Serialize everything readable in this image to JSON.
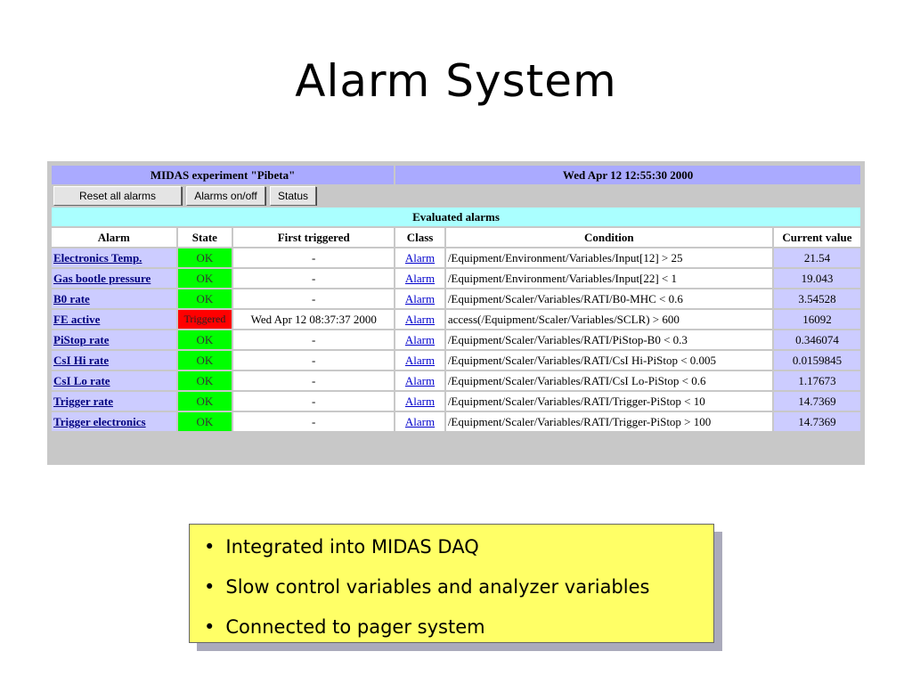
{
  "slide": {
    "title": "Alarm System"
  },
  "panel": {
    "experiment_title": "MIDAS experiment \"Pibeta\"",
    "datetime": "Wed Apr 12 12:55:30 2000",
    "buttons": {
      "reset": "Reset all alarms",
      "toggle": "Alarms on/off",
      "status": "Status"
    },
    "section_title": "Evaluated alarms",
    "columns": [
      "Alarm",
      "State",
      "First triggered",
      "Class",
      "Condition",
      "Current value"
    ],
    "rows": [
      {
        "alarm": "Electronics Temp.",
        "state": "OK",
        "first_triggered": "-",
        "class": "Alarm",
        "condition": "/Equipment/Environment/Variables/Input[12] > 25",
        "value": "21.54"
      },
      {
        "alarm": "Gas bootle pressure",
        "state": "OK",
        "first_triggered": "-",
        "class": "Alarm",
        "condition": "/Equipment/Environment/Variables/Input[22] < 1",
        "value": "19.043"
      },
      {
        "alarm": "B0 rate",
        "state": "OK",
        "first_triggered": "-",
        "class": "Alarm",
        "condition": "/Equipment/Scaler/Variables/RATI/B0-MHC < 0.6",
        "value": "3.54528"
      },
      {
        "alarm": "FE active",
        "state": "Triggered",
        "first_triggered": "Wed Apr 12 08:37:37 2000",
        "class": "Alarm",
        "condition": "access(/Equipment/Scaler/Variables/SCLR) > 600",
        "value": "16092"
      },
      {
        "alarm": "PiStop rate",
        "state": "OK",
        "first_triggered": "-",
        "class": "Alarm",
        "condition": "/Equipment/Scaler/Variables/RATI/PiStop-B0 < 0.3",
        "value": "0.346074"
      },
      {
        "alarm": "CsI Hi rate",
        "state": "OK",
        "first_triggered": "-",
        "class": "Alarm",
        "condition": "/Equipment/Scaler/Variables/RATI/CsI Hi-PiStop < 0.005",
        "value": "0.0159845"
      },
      {
        "alarm": "CsI Lo rate",
        "state": "OK",
        "first_triggered": "-",
        "class": "Alarm",
        "condition": "/Equipment/Scaler/Variables/RATI/CsI Lo-PiStop < 0.6",
        "value": "1.17673"
      },
      {
        "alarm": "Trigger rate",
        "state": "OK",
        "first_triggered": "-",
        "class": "Alarm",
        "condition": "/Equipment/Scaler/Variables/RATI/Trigger-PiStop < 10",
        "value": "14.7369"
      },
      {
        "alarm": "Trigger electronics",
        "state": "OK",
        "first_triggered": "-",
        "class": "Alarm",
        "condition": "/Equipment/Scaler/Variables/RATI/Trigger-PiStop > 100",
        "value": "14.7369"
      }
    ]
  },
  "note": {
    "bullets": [
      "Integrated into MIDAS DAQ",
      "Slow control variables and analyzer variables",
      "Connected to pager system"
    ]
  },
  "colors": {
    "ok": "#00ff00",
    "triggered": "#ff0000",
    "header": "#aaaaff",
    "section": "#aaffff",
    "note": "#ffff66"
  }
}
